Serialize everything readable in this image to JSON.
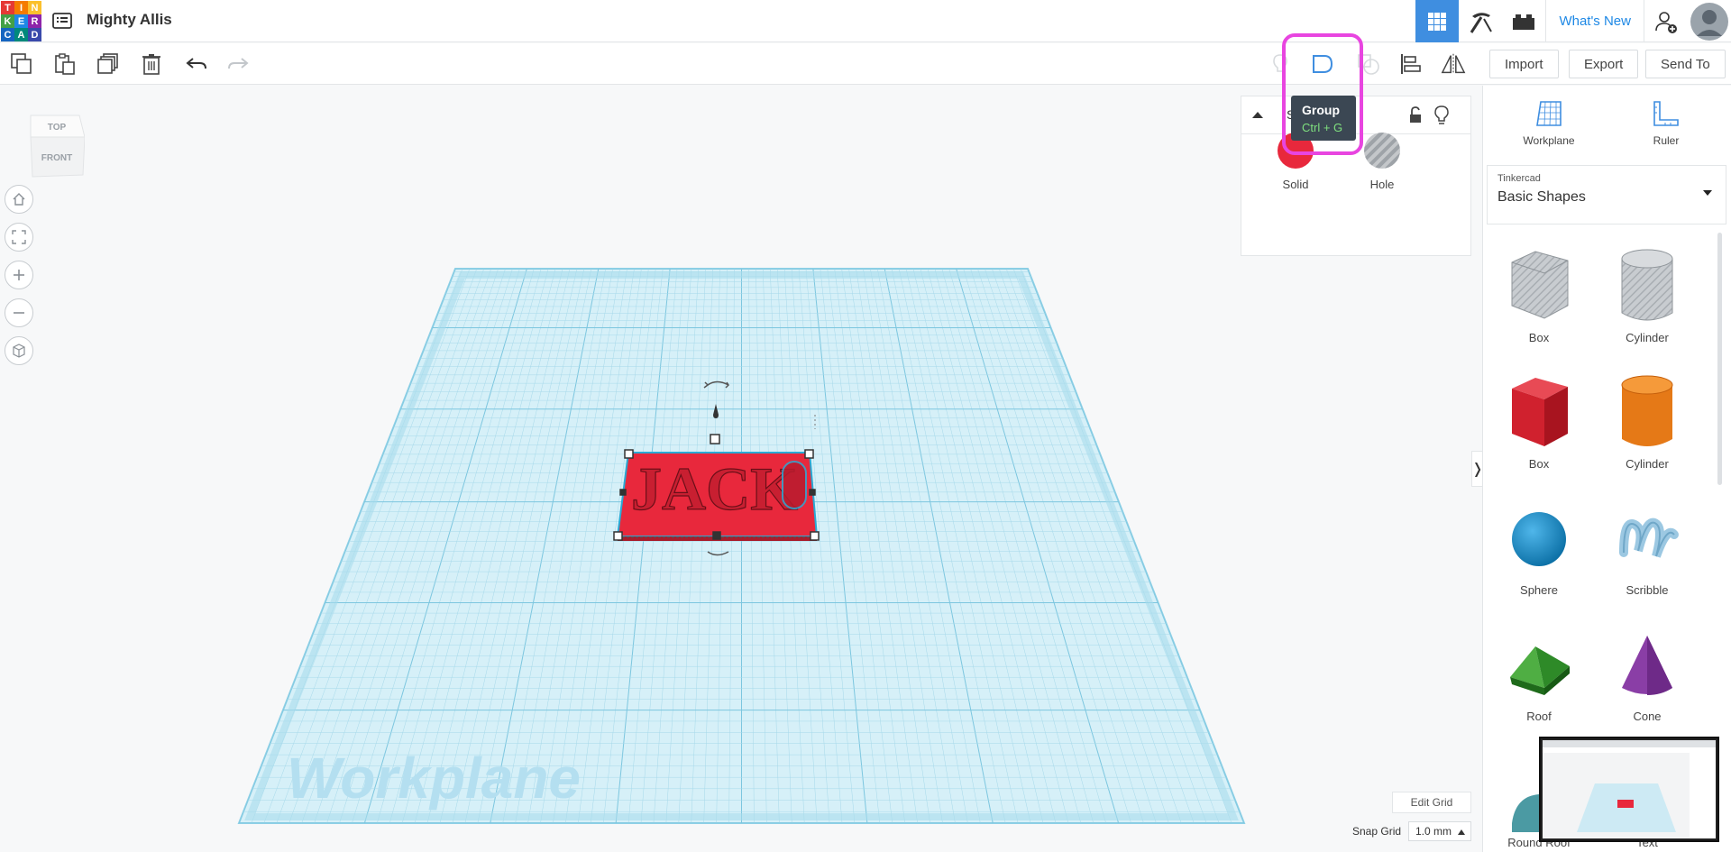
{
  "app": {
    "logo_letters": [
      "T",
      "I",
      "N",
      "K",
      "E",
      "R",
      "C",
      "A",
      "D"
    ],
    "logo_colors": [
      "#e53935",
      "#f57c00",
      "#fbc02d",
      "#43a047",
      "#1e88e5",
      "#8e24aa",
      "#1565c0",
      "#00897b",
      "#3949ab"
    ],
    "design_name": "Mighty Allis"
  },
  "header": {
    "whats_new": "What's New",
    "accent_color": "#3f8ee0",
    "right_icons": [
      "grid-view-icon",
      "pickaxe-icon",
      "bricks-icon",
      "add-user-icon",
      "user-avatar"
    ]
  },
  "toolbar": {
    "left_icons": [
      "copy-icon",
      "paste-icon",
      "duplicate-icon",
      "delete-icon",
      "undo-icon",
      "redo-icon"
    ],
    "right_icons": [
      "show-all-icon",
      "group-icon",
      "ungroup-icon",
      "align-icon",
      "mirror-icon"
    ],
    "import_label": "Import",
    "export_label": "Export",
    "send_to_label": "Send To"
  },
  "viewcube": {
    "top_label": "TOP",
    "front_label": "FRONT"
  },
  "left_nav": [
    "home-icon",
    "fit-view-icon",
    "zoom-in-icon",
    "zoom-out-icon",
    "ortho-icon"
  ],
  "tooltip": {
    "title": "Group",
    "shortcut": "Ctrl + G"
  },
  "inspector": {
    "title_partial": "S",
    "solid_label": "Solid",
    "hole_label": "Hole",
    "solid_color": "#e8283c"
  },
  "canvas": {
    "workplane_watermark": "Workplane",
    "object_text": "JACK"
  },
  "panel": {
    "workplane_label": "Workplane",
    "ruler_label": "Ruler",
    "library_source": "Tinkercad",
    "library_name": "Basic Shapes",
    "shapes": [
      "Box",
      "Cylinder",
      "Box",
      "Cylinder",
      "Sphere",
      "Scribble",
      "Roof",
      "Cone",
      "Round Roof",
      "Text"
    ]
  },
  "grid": {
    "edit_grid_label": "Edit Grid",
    "snap_grid_label": "Snap Grid",
    "snap_grid_value": "1.0 mm"
  }
}
